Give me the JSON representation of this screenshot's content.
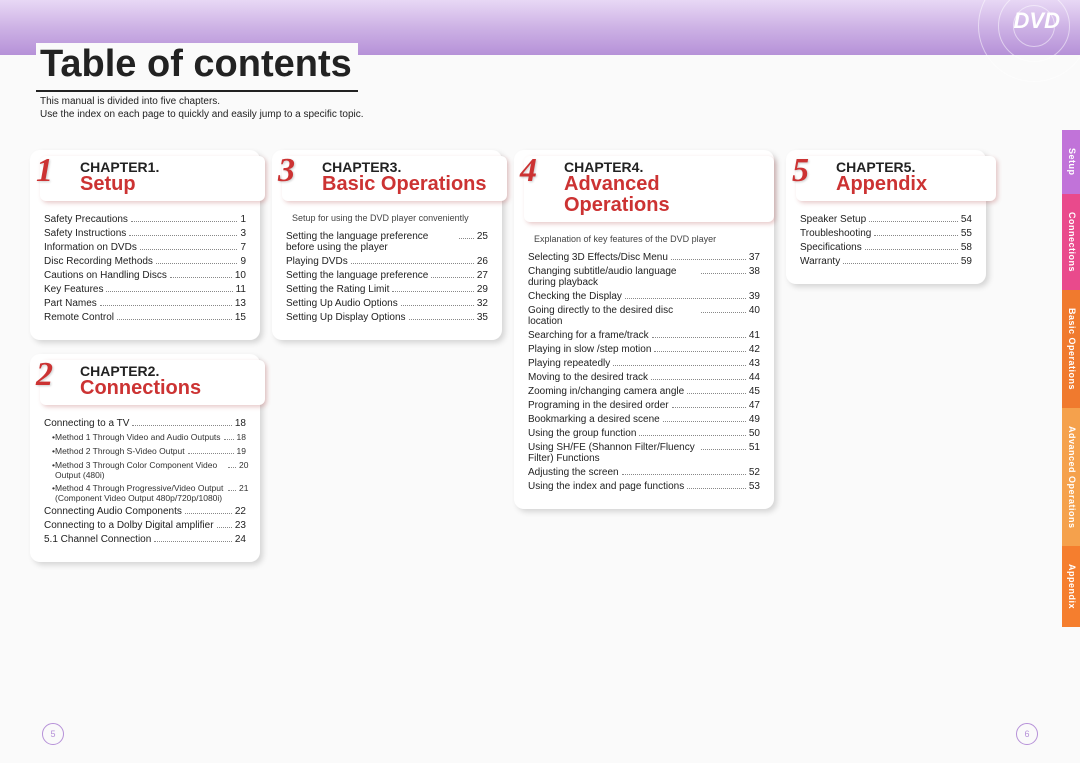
{
  "logo": "DVD",
  "mainTitle": "Table of contents",
  "introLine1": "This manual is divided into five chapters.",
  "introLine2": "Use the index on each page to quickly and easily jump to a specific topic.",
  "pageLeft": "5",
  "pageRight": "6",
  "tabs": {
    "setup": "Setup",
    "conn": "Connections",
    "basic": "Basic Operations",
    "adv": "Advanced Operations",
    "app": "Appendix"
  },
  "ch1": {
    "num": "1",
    "label": "CHAPTER1.",
    "title": "Setup",
    "items": [
      {
        "t": "Safety Precautions",
        "p": "1"
      },
      {
        "t": "Safety Instructions",
        "p": "3"
      },
      {
        "t": "Information on DVDs",
        "p": "7"
      },
      {
        "t": "Disc Recording Methods",
        "p": "9"
      },
      {
        "t": "Cautions on Handling Discs",
        "p": "10"
      },
      {
        "t": "Key Features",
        "p": "11"
      },
      {
        "t": "Part Names",
        "p": "13"
      },
      {
        "t": "Remote Control",
        "p": "15"
      }
    ]
  },
  "ch2": {
    "num": "2",
    "label": "CHAPTER2.",
    "title": "Connections",
    "items": [
      {
        "t": "Connecting to a TV",
        "p": "18"
      },
      {
        "t": "Method 1 Through Video and Audio Outputs",
        "p": "18",
        "sub": true
      },
      {
        "t": "Method 2 Through S-Video Output",
        "p": "19",
        "sub": true
      },
      {
        "t": "Method 3 Through Color Component Video Output (480i)",
        "p": "20",
        "sub": true
      },
      {
        "t": "Method 4 Through Progressive/Video Output (Component Video Output 480p/720p/1080i)",
        "p": "21",
        "sub": true
      },
      {
        "t": "Connecting Audio Components",
        "p": "22"
      },
      {
        "t": "Connecting to a Dolby Digital amplifier",
        "p": "23"
      },
      {
        "t": "5.1 Channel Connection",
        "p": "24"
      }
    ]
  },
  "ch3": {
    "num": "3",
    "label": "CHAPTER3.",
    "title": "Basic Operations",
    "note": "Setup for using the DVD player conveniently",
    "items": [
      {
        "t": "Setting the language preference before using the player",
        "p": "25"
      },
      {
        "t": "Playing DVDs",
        "p": "26"
      },
      {
        "t": "Setting the language preference",
        "p": "27"
      },
      {
        "t": "Setting the Rating Limit",
        "p": "29"
      },
      {
        "t": "Setting Up Audio Options",
        "p": "32"
      },
      {
        "t": "Setting Up Display Options",
        "p": "35"
      }
    ]
  },
  "ch4": {
    "num": "4",
    "label": "CHAPTER4.",
    "title": "Advanced Operations",
    "note": "Explanation of key features of the DVD player",
    "items": [
      {
        "t": "Selecting 3D Effects/Disc Menu",
        "p": "37"
      },
      {
        "t": "Changing subtitle/audio language during playback",
        "p": "38"
      },
      {
        "t": "Checking the Display",
        "p": "39"
      },
      {
        "t": "Going directly to the desired disc location",
        "p": "40"
      },
      {
        "t": "Searching for a frame/track",
        "p": "41"
      },
      {
        "t": "Playing in slow /step motion",
        "p": "42"
      },
      {
        "t": "Playing repeatedly",
        "p": "43"
      },
      {
        "t": "Moving to the desired track",
        "p": "44"
      },
      {
        "t": "Zooming in/changing camera angle",
        "p": "45"
      },
      {
        "t": "Programing in the desired order",
        "p": "47"
      },
      {
        "t": "Bookmarking a desired scene",
        "p": "49"
      },
      {
        "t": "Using the group function",
        "p": "50"
      },
      {
        "t": "Using SH/FE (Shannon Filter/Fluency Filter) Functions",
        "p": "51"
      },
      {
        "t": "Adjusting the screen",
        "p": "52"
      },
      {
        "t": "Using the index and page functions",
        "p": "53"
      }
    ]
  },
  "ch5": {
    "num": "5",
    "label": "CHAPTER5.",
    "title": "Appendix",
    "items": [
      {
        "t": "Speaker Setup",
        "p": "54"
      },
      {
        "t": "Troubleshooting",
        "p": "55"
      },
      {
        "t": "Specifications",
        "p": "58"
      },
      {
        "t": "Warranty",
        "p": "59"
      }
    ]
  }
}
